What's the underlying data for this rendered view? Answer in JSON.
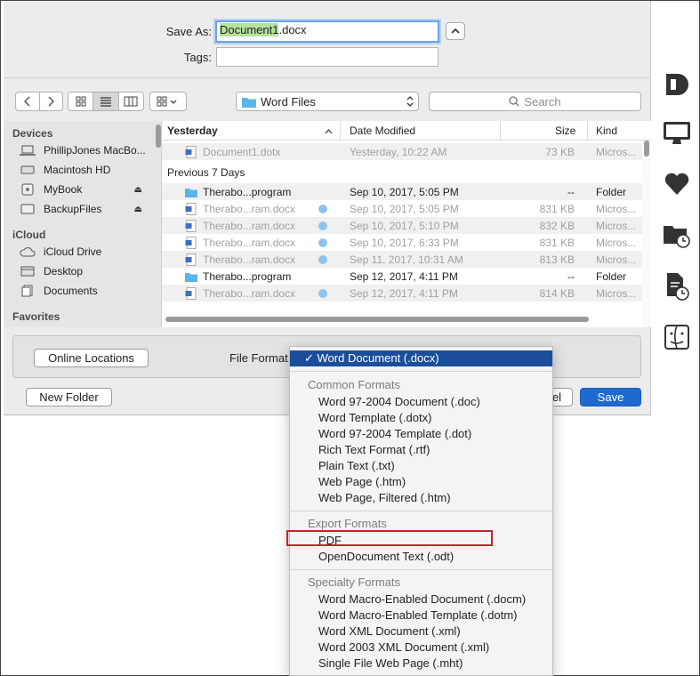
{
  "save_as": {
    "label": "Save As:",
    "filename_highlight": "Document1",
    "filename_ext": ".docx"
  },
  "tags": {
    "label": "Tags:",
    "value": ""
  },
  "toolbar": {
    "location": "Word Files",
    "search_placeholder": "Search"
  },
  "sidebar": {
    "devices_header": "Devices",
    "devices": [
      "PhillipJones MacBo...",
      "Macintosh HD",
      "MyBook",
      "BackupFiles"
    ],
    "icloud_header": "iCloud",
    "icloud": [
      "iCloud Drive",
      "Desktop",
      "Documents"
    ],
    "favorites_header": "Favorites"
  },
  "columns": {
    "name": "Yesterday",
    "date": "Date Modified",
    "size": "Size",
    "kind": "Kind"
  },
  "groups": {
    "previous": "Previous 7 Days"
  },
  "rows": [
    {
      "name": "Document1.dotx",
      "date": "Yesterday, 10:22 AM",
      "size": "73 KB",
      "kind": "Micros..."
    },
    {
      "name": "Therabo...program",
      "date": "Sep 10, 2017, 5:05 PM",
      "size": "--",
      "kind": "Folder"
    },
    {
      "name": "Therabo...ram.docx",
      "date": "Sep 10, 2017, 5:05 PM",
      "size": "831 KB",
      "kind": "Micros..."
    },
    {
      "name": "Therabo...ram.docx",
      "date": "Sep 10, 2017, 5:10 PM",
      "size": "832 KB",
      "kind": "Micros..."
    },
    {
      "name": "Therabo...ram.docx",
      "date": "Sep 10, 2017, 6:33 PM",
      "size": "831 KB",
      "kind": "Micros..."
    },
    {
      "name": "Therabo...ram.docx",
      "date": "Sep 11, 2017, 10:31 AM",
      "size": "813 KB",
      "kind": "Micros..."
    },
    {
      "name": "Therabo...program",
      "date": "Sep 12, 2017, 4:11 PM",
      "size": "--",
      "kind": "Folder"
    },
    {
      "name": "Therabo...ram.docx",
      "date": "Sep 12, 2017, 4:11 PM",
      "size": "814 KB",
      "kind": "Micros..."
    }
  ],
  "buttons": {
    "online_locations": "Online Locations",
    "new_folder": "New Folder",
    "cancel_partial": "el",
    "save": "Save"
  },
  "file_format": {
    "label": "File Format"
  },
  "menu": {
    "selected": "✓ Word Document (.docx)",
    "common_header": "Common Formats",
    "common": [
      "Word 97-2004 Document (.doc)",
      "Word Template (.dotx)",
      "Word 97-2004 Template (.dot)",
      "Rich Text Format (.rtf)",
      "Plain Text (.txt)",
      "Web Page (.htm)",
      "Web Page, Filtered (.htm)"
    ],
    "export_header": "Export Formats",
    "export": [
      "PDF",
      "OpenDocument Text (.odt)"
    ],
    "specialty_header": "Specialty Formats",
    "specialty": [
      "Word Macro-Enabled Document (.docm)",
      "Word Macro-Enabled Template (.dotm)",
      "Word XML Document (.xml)",
      "Word 2003 XML Document (.xml)",
      "Single File Web Page (.mht)"
    ]
  },
  "colors": {
    "accent": "#1f6ad0",
    "menu_selected": "#1b4e9a",
    "highlight": "#b6e29d",
    "annotation_box": "#c0282a",
    "folder": "#5ab4ea"
  },
  "icons": [
    "chevron-up-icon",
    "back-icon",
    "forward-icon",
    "icon-view-icon",
    "list-view-icon",
    "column-view-icon",
    "group-icon",
    "folder-icon",
    "search-icon",
    "laptop-icon",
    "disk-icon",
    "eject-icon",
    "cloud-icon",
    "desktop-icon",
    "documents-icon",
    "word-doc-icon",
    "document-d-icon",
    "monitor-icon",
    "heart-icon",
    "recent-folder-icon",
    "recent-doc-icon",
    "finder-icon"
  ]
}
